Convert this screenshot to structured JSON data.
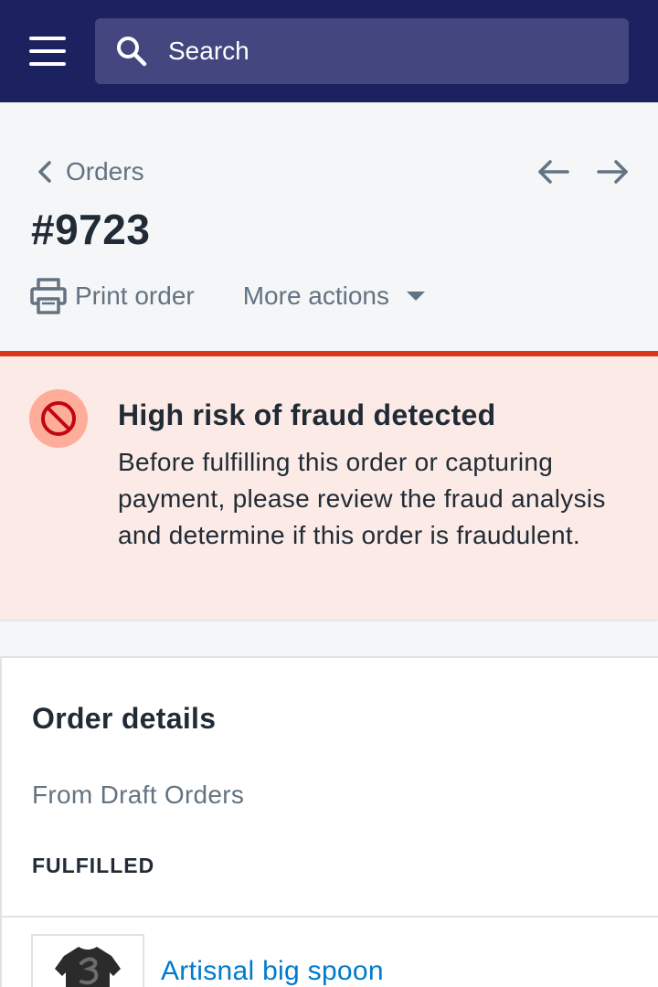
{
  "topbar": {
    "menu_icon": "hamburger-menu-icon",
    "search": {
      "placeholder": "Search",
      "icon": "search-icon"
    }
  },
  "header": {
    "breadcrumb": {
      "label": "Orders",
      "icon": "chevron-left-icon"
    },
    "pagination": {
      "prev_icon": "arrow-left-icon",
      "next_icon": "arrow-right-icon"
    },
    "title": "#9723",
    "actions": {
      "print_label": "Print order",
      "print_icon": "printer-icon",
      "more_label": "More actions",
      "more_icon": "caret-down-icon"
    }
  },
  "banner": {
    "title": "High risk of fraud detected",
    "text": "Before fulfilling this order or capturing payment, please review the fraud analysis and determine if this order is fraudulent.",
    "icon": "blocked-icon",
    "colors": {
      "background": "#fbeae5",
      "border": "#de3618",
      "icon_bg": "#fead9a",
      "icon": "#bf0711"
    }
  },
  "order_details": {
    "title": "Order details",
    "subtitle": "From Draft Orders",
    "status": "FULFILLED",
    "items": [
      {
        "name": "Artisnal big spoon"
      }
    ]
  },
  "colors": {
    "topbar": "#1c2260",
    "search_bg": "#43467f",
    "link": "#007ace",
    "muted_text": "#637381"
  }
}
